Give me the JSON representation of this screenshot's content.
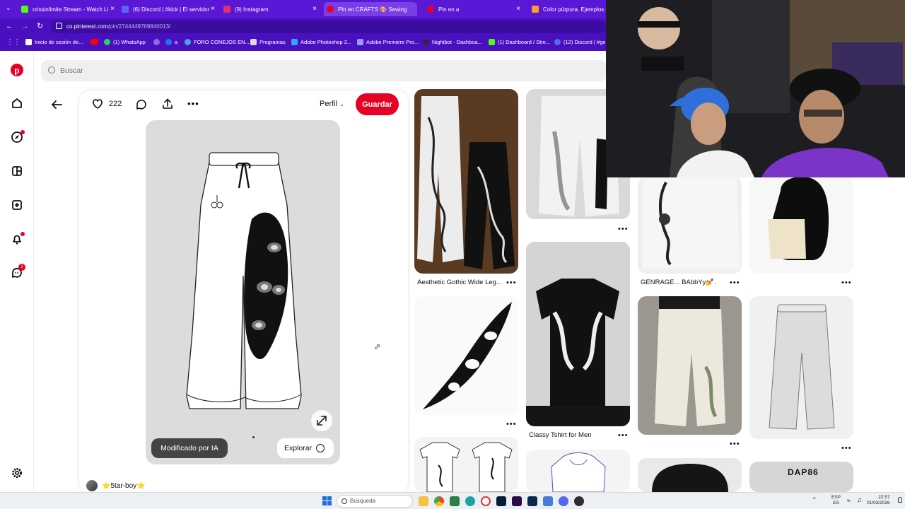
{
  "browser": {
    "tabs": [
      {
        "label": "crissinlimite Stream - Watch Li",
        "color": "#53fc18"
      },
      {
        "label": "(6) Discord | #kick | El servidor",
        "color": "#5865f2"
      },
      {
        "label": "(9) Instagram",
        "color": "#e1306c"
      },
      {
        "label": "Pin en CRAFTS 🎨 Sewing",
        "color": "#e60023"
      },
      {
        "label": "Pin en a",
        "color": "#e60023"
      },
      {
        "label": "Color púrpura. Ejemplos de c",
        "color": "#f4a02a"
      }
    ],
    "url_domain": "co.pinterest.com",
    "url_path": "/pin/2744449769840013/",
    "bookmarks": [
      {
        "label": "Inicio de sesión de...",
        "color": "#ffffff"
      },
      {
        "label": "(1) WhatsApp",
        "color": "#25d366"
      },
      {
        "label": "a",
        "color": "#1877f2"
      },
      {
        "label": "FORO CONEJOS EN...",
        "color": "#4aa3df"
      },
      {
        "label": "Programas",
        "color": "#dddddd"
      },
      {
        "label": "Adobe Photoshop 2...",
        "color": "#31a8ff"
      },
      {
        "label": "Adobe Premiere Pro...",
        "color": "#9999ff"
      },
      {
        "label": "Nightbot - Dashboa...",
        "color": "#2b2b2b"
      },
      {
        "label": "(1) Dashboard / Stre...",
        "color": "#53fc18"
      },
      {
        "label": "(12) Discord | #ger",
        "color": "#5865f2"
      }
    ]
  },
  "search": {
    "placeholder": "Buscar"
  },
  "pin": {
    "likes": "222",
    "profile_label": "Perfil",
    "save_label": "Guardar",
    "ai_badge": "Modificado por IA",
    "explore_label": "Explorar",
    "user": "⭐5tar-boy⭐"
  },
  "feed": {
    "captions": [
      "Aesthetic Gothic Wide Leg...",
      "GENRAGE... BAbbYy💅.",
      "Classy Tshirt for Men"
    ],
    "dap_text": "DAP86"
  },
  "taskbar": {
    "search_label": "Búsqueda",
    "lang": "ESP",
    "lang_sub": "ES",
    "time": "22:57",
    "date": "01/03/2026"
  },
  "icons": {
    "like": "heart-icon",
    "comment": "comment-icon",
    "share": "share-icon",
    "more": "more-icon",
    "back": "back-arrow-icon",
    "expand": "expand-icon"
  },
  "colors": {
    "pinterest_red": "#e60023",
    "browser_purple": "#5a17d6",
    "card_gray": "#dcdcdc"
  }
}
